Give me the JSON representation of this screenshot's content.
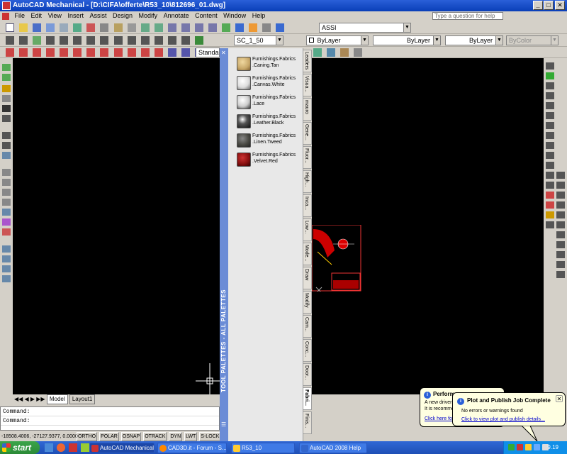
{
  "window": {
    "title": "AutoCAD Mechanical - [D:\\CIFA\\offerte\\R53_10\\812696_01.dwg]",
    "controls": {
      "minimize": "_",
      "maximize": "□",
      "close": "✕"
    }
  },
  "menu": {
    "items": [
      "File",
      "Edit",
      "View",
      "Insert",
      "Assist",
      "Design",
      "Modify",
      "Annotate",
      "Content",
      "Window",
      "Help"
    ],
    "help_placeholder": "Type a question for help"
  },
  "toolbar": {
    "layer_combo": "ASSI",
    "scale_combo": "SC_1_50",
    "text_style_combo": "Standa",
    "color_combo": "ByLayer",
    "linetype_combo": "ByLayer",
    "lineweight_combo": "ByLayer",
    "plotstyle_combo": "ByColor"
  },
  "palette": {
    "vertical_title": "TOOL PALETTES - ALL PALETTES",
    "items": [
      {
        "label_1": "Furnishings.Fabrics",
        "label_2": ".Caning.Tan",
        "color": "#c8a86a"
      },
      {
        "label_1": "Furnishings.Fabrics",
        "label_2": ".Canvas.White",
        "color": "#f0f0f0"
      },
      {
        "label_1": "Furnishings.Fabrics",
        "label_2": ".Lace",
        "color": "#e8e4dc"
      },
      {
        "label_1": "Furnishings.Fabrics",
        "label_2": ".Leather.Black",
        "color": "#2a2a2a"
      },
      {
        "label_1": "Furnishings.Fabrics",
        "label_2": ".Linen.Tweed",
        "color": "#4a4a44"
      },
      {
        "label_1": "Furnishings.Fabrics",
        "label_2": ".Velvet.Red",
        "color": "#8a1010"
      }
    ],
    "tabs": [
      "Leaders",
      "Visua...",
      "mauro",
      "Gene...",
      "Fluor...",
      "High...",
      "Inca...",
      "Low...",
      "Mode...",
      "Draw",
      "Modify",
      "Cam...",
      "Conc...",
      "Door...",
      "Fabri...",
      "Finis..."
    ],
    "active_tab": "Fabri..."
  },
  "layout_tabs": {
    "model": "Model",
    "layout1": "Layout1"
  },
  "command": {
    "line1": "Command:",
    "line2": "Command:"
  },
  "status": {
    "coords": "-18508.4006, -27127.9377, 0.0000",
    "buttons": [
      "ORTHO",
      "POLAR",
      "OSNAP",
      "OTRACK",
      "DYN",
      "LWT",
      "S-LOCK"
    ]
  },
  "balloon_perf": {
    "title": "Performa...",
    "line1": "A new driver h...",
    "line2": "It is recommen...",
    "link": "Click here for..."
  },
  "balloon_plot": {
    "title": "Plot and Publish Job Complete",
    "message": "No errors or warnings found",
    "link": "Click to view plot and publish details..."
  },
  "taskbar": {
    "start": "start",
    "buttons": [
      {
        "label": "AutoCAD Mechanical ...",
        "color": "#c33"
      },
      {
        "label": "CAD3D.it - Forum - S...",
        "color": "#f80"
      },
      {
        "label": "R53_10",
        "color": "#fc3"
      },
      {
        "label": "AutoCAD 2008 Help",
        "color": "#36c"
      }
    ],
    "clock": "9.19"
  }
}
